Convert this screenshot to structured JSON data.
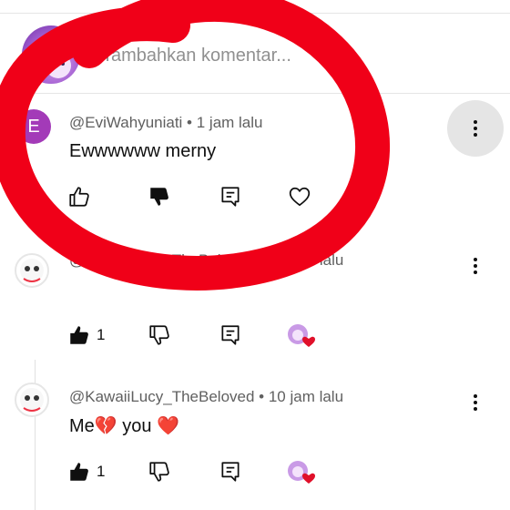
{
  "composer": {
    "placeholder": "Tambahkan komentar..."
  },
  "comments": [
    {
      "avatar_letter": "E",
      "avatar_color": "#a33ab8",
      "author": "@EviWahyuniati",
      "time": "1 jam lalu",
      "meta": "@EviWahyuniati • 1 jam lalu",
      "text": "Ewwwwww merny",
      "like_count": "",
      "liked": false,
      "disliked": true,
      "creator_hearted": false
    },
    {
      "author": "@KawaiiLucy_TheBeloved",
      "time": "10 jam lalu",
      "meta_visible_left": "@KawaiiLucy_TheBelov",
      "meta_visible_right": "m lalu",
      "like_count": "1",
      "liked": true,
      "disliked": false,
      "creator_hearted": true
    },
    {
      "author": "@KawaiiLucy_TheBeloved",
      "time": "10 jam lalu",
      "meta": "@KawaiiLucy_TheBeloved • 10 jam lalu",
      "text_start": "Me",
      "text_broken_heart": "💔",
      "text_middle": " you ",
      "text_heart": "❤️",
      "like_count": "1",
      "liked": true,
      "disliked": false,
      "creator_hearted": true
    }
  ],
  "colors": {
    "annotation_red": "#f00018",
    "heart_red": "#e0102a",
    "separator": "#e5e5e5",
    "meta_gray": "#606060"
  },
  "icons": [
    "thumb-up-icon",
    "thumb-down-icon",
    "reply-icon",
    "heart-icon",
    "more-vert-icon"
  ]
}
